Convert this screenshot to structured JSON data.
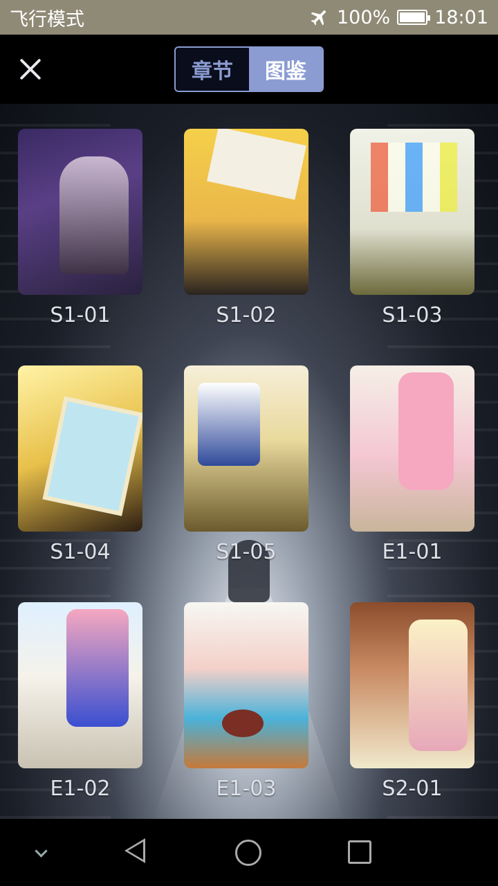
{
  "status_bar": {
    "mode": "飞行模式",
    "battery": "100%",
    "battery_level": 1.0,
    "time": "18:01",
    "icons": [
      "airplane-icon",
      "battery-icon"
    ]
  },
  "header": {
    "close_icon": "close-icon",
    "tabs": [
      {
        "label": "章节",
        "selected": false
      },
      {
        "label": "图鉴",
        "selected": true
      }
    ]
  },
  "gallery": {
    "items": [
      {
        "label": "S1-01"
      },
      {
        "label": "S1-02"
      },
      {
        "label": "S1-03"
      },
      {
        "label": "S1-04"
      },
      {
        "label": "S1-05"
      },
      {
        "label": "E1-01"
      },
      {
        "label": "E1-02"
      },
      {
        "label": "E1-03"
      },
      {
        "label": "S2-01"
      }
    ]
  },
  "nav_bar": {
    "icons": [
      "chevron-down-icon",
      "back-icon",
      "home-icon",
      "recent-apps-icon"
    ]
  },
  "colors": {
    "accent": "#8b9cd2",
    "status_bar": "#8f8a76"
  }
}
